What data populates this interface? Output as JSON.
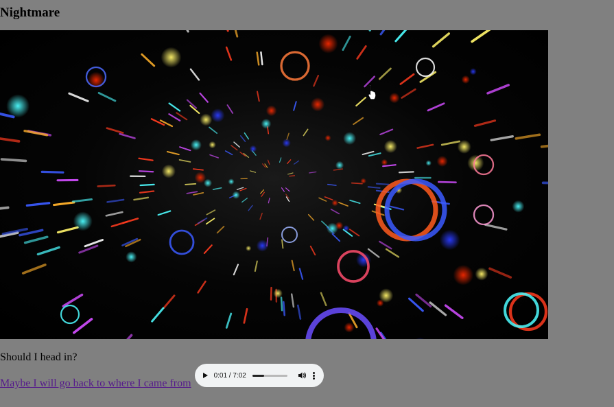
{
  "page": {
    "heading": "Nightmare",
    "question": "Should I head in?",
    "link_text": "Maybe I will go back to where I came from"
  },
  "image": {
    "icon": "kaleidoscope-tunnel-image"
  },
  "audio_player": {
    "time": "0:01 / 7:02",
    "progress_fraction": 0.33,
    "icons": [
      "play-icon",
      "volume-icon",
      "more-options-icon"
    ]
  },
  "cursor": {
    "icon": "hand-pointer-cursor"
  }
}
